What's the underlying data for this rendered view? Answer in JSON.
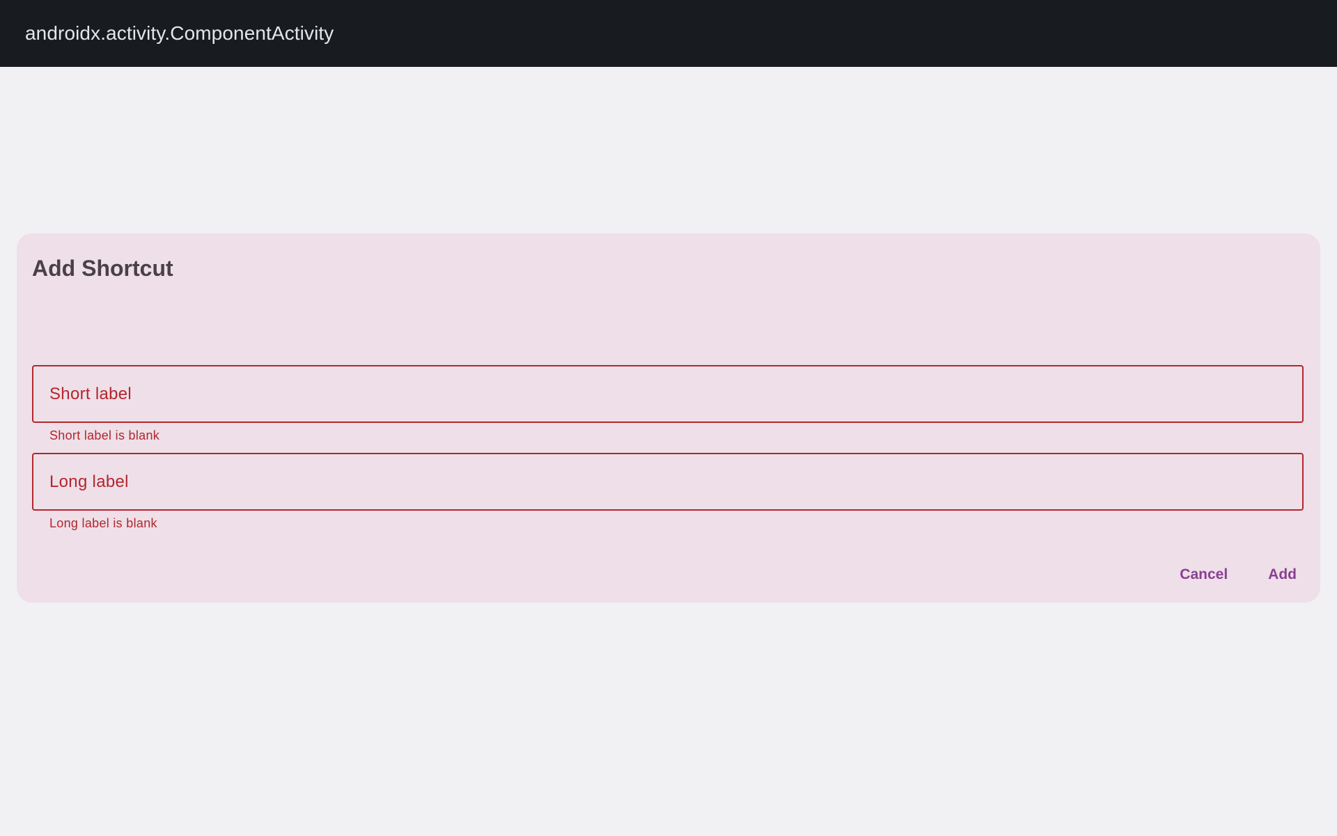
{
  "window": {
    "title": "androidx.activity.ComponentActivity"
  },
  "dialog": {
    "title": "Add Shortcut",
    "fields": [
      {
        "label": "Short label",
        "value": "",
        "error": "Short label is blank"
      },
      {
        "label": "Long label",
        "value": "",
        "error": "Long label is blank"
      }
    ],
    "buttons": {
      "cancel": "Cancel",
      "add": "Add"
    }
  },
  "colors": {
    "titlebar": "#181b1f",
    "background": "#f1f1f3",
    "dialog_surface": "#eedfe8",
    "error": "#b3262d",
    "accent": "#8a3f93"
  }
}
